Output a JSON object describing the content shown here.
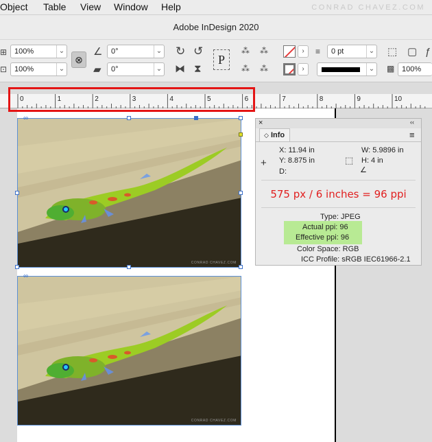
{
  "menubar": {
    "items": [
      "Object",
      "Table",
      "View",
      "Window",
      "Help"
    ],
    "watermark": "CONRAD CHAVEZ.COM"
  },
  "app": {
    "title": "Adobe InDesign 2020"
  },
  "controlbar": {
    "scale_x": "100%",
    "scale_y": "100%",
    "rotate_angle": "0°",
    "shear_angle": "0°",
    "para_symbol": "P",
    "stroke_weight": "0 pt",
    "opacity": "100%",
    "icons": [
      "reference-point-icon",
      "constrain-link-icon",
      "rotate-icon",
      "shear-icon",
      "rotate-cw-icon",
      "rotate-ccw-icon",
      "flip-horizontal-icon",
      "flip-vertical-icon",
      "distribute-icon",
      "fill-swatch-icon",
      "stroke-swatch-icon",
      "select-container-icon",
      "drop-shadow-icon",
      "effects-icon"
    ]
  },
  "ruler": {
    "labels": [
      "0",
      "1",
      "2",
      "3",
      "4",
      "5",
      "6",
      "7",
      "8",
      "9",
      "10"
    ]
  },
  "document": {
    "image_credit": "CONRAD CHAVEZ.COM"
  },
  "info_panel": {
    "tab_label": "Info",
    "close_glyph": "×",
    "collapse_glyph": "‹‹",
    "menu_glyph": "≡",
    "x": "X: 11.94 in",
    "y": "Y: 8.875 in",
    "d": "D:",
    "w": "W: 5.9896 in",
    "h": "H: 4 in",
    "annotation": "575 px / 6 inches = 96 ppi",
    "type": "Type: JPEG",
    "actual_ppi": "Actual ppi: 96",
    "effective_ppi": "Effective ppi: 96",
    "color_space": "Color Space: RGB",
    "icc_profile": "ICC Profile: sRGB IEC61966-2.1"
  },
  "colors": {
    "highlight": "#b8ea94",
    "annotation": "#e11f1f",
    "callout_box": "#e41515",
    "selection": "#3a6fc9"
  }
}
